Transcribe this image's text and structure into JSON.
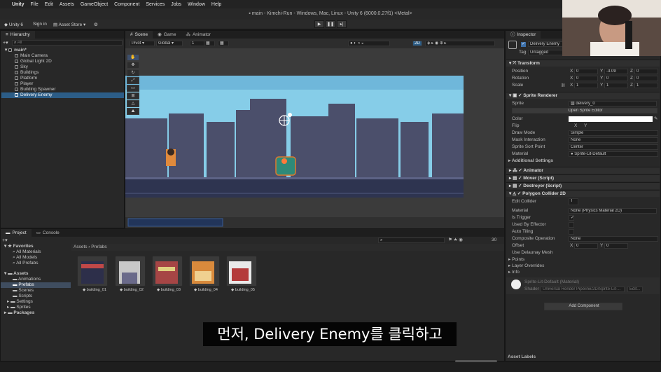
{
  "menubar": {
    "app": "Unity",
    "items": [
      "File",
      "Edit",
      "Assets",
      "GameObject",
      "Component",
      "Services",
      "Jobs",
      "Window",
      "Help"
    ],
    "keyboard_indicator": "A"
  },
  "titlebar": {
    "title": "main - Kimchi-Run - Windows, Mac, Linux - Unity 6 (6000.0.27f1) <Metal>"
  },
  "toolbar": {
    "account": "Unity 6",
    "signin": "Sign in",
    "asset_store": "Asset Store ▾"
  },
  "hierarchy": {
    "tab": "Hierarchy",
    "search_placeholder": "All",
    "scene": "main*",
    "items": [
      "Main Camera",
      "Global Light 2D",
      "Sky",
      "Buildings",
      "Platform",
      "Player",
      "Building Spawner",
      "Delivery Enemy"
    ],
    "selected": "Delivery Enemy"
  },
  "scene_view": {
    "tabs": [
      "Scene",
      "Game",
      "Animator"
    ],
    "pivot": "Pivot ▾",
    "global": "Global ▾",
    "grid_value": "1",
    "mode_2d": "2D"
  },
  "inspector": {
    "tab": "Inspector",
    "object_name": "Delivery Enemy",
    "tag_label": "Tag",
    "tag_value": "Untagged",
    "transform": {
      "title": "Transform",
      "position_label": "Position",
      "rotation_label": "Rotation",
      "scale_label": "Scale",
      "position": {
        "x": "0",
        "y": "-3.09",
        "z": "0"
      },
      "rotation": {
        "x": "0",
        "y": "0",
        "z": "0"
      },
      "scale": {
        "x": "1",
        "y": "1",
        "z": "1"
      },
      "x_label": "X",
      "y_label": "Y",
      "z_label": "Z"
    },
    "sprite_renderer": {
      "title": "Sprite Renderer",
      "sprite_label": "Sprite",
      "sprite_value": "delivery_0",
      "open_editor": "Open Sprite Editor",
      "color_label": "Color",
      "flip_label": "Flip",
      "flip_x": "X",
      "flip_y": "Y",
      "draw_mode_label": "Draw Mode",
      "draw_mode_value": "Simple",
      "mask_label": "Mask Interaction",
      "mask_value": "None",
      "sort_label": "Sprite Sort Point",
      "sort_value": "Center",
      "material_label": "Material",
      "material_value": "Sprite-Lit-Default",
      "additional": "Additional Settings"
    },
    "components": [
      "Animator",
      "Mover (Script)",
      "Destroyer (Script)",
      "Polygon Collider 2D"
    ],
    "collider": {
      "edit_label": "Edit Collider",
      "material_label": "Material",
      "material_value": "None (Physics Material 2D)",
      "trigger_label": "Is Trigger",
      "effector_label": "Used By Effector",
      "tiling_label": "Auto Tiling",
      "composite_label": "Composite Operation",
      "composite_value": "None",
      "offset_label": "Offset",
      "offset": {
        "x": "0",
        "y": "0"
      },
      "delaunay_label": "Use Delaunay Mesh",
      "points_label": "Points",
      "layer_label": "Layer Overrides",
      "info_label": "Info"
    },
    "material_asset": {
      "name": "Sprite-Lit-Default (Material)",
      "shader_label": "Shader",
      "shader_value": "Universal Render Pipeline/2D/Sprite-Lit-...",
      "edit": "Edit..."
    },
    "add_component": "Add Component",
    "asset_labels": "Asset Labels"
  },
  "project": {
    "tabs": [
      "Project",
      "Console"
    ],
    "favorites_title": "Favorites",
    "favorites": [
      "All Materials",
      "All Models",
      "All Prefabs"
    ],
    "assets_title": "Assets",
    "folders": [
      "Animations",
      "Prefabs",
      "Scenes",
      "Scripts",
      "Settings",
      "Sprites"
    ],
    "packages": "Packages",
    "breadcrumb": "Assets › Prefabs",
    "count_badge": "30",
    "prefabs": [
      "building_01",
      "building_02",
      "building_03",
      "building_04",
      "building_05"
    ]
  },
  "subtitle": "먼저, Delivery Enemy를 클릭하고",
  "colors": {
    "selection": "#2c5d87",
    "sky": "#7fc9e6",
    "building": "#4b4f6b",
    "ground": "#2e3450"
  }
}
